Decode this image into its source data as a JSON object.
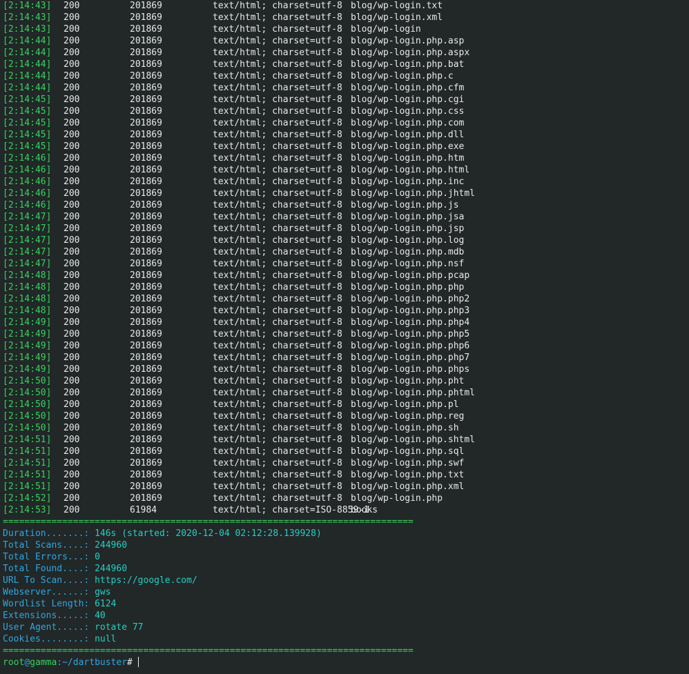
{
  "log_entries": [
    {
      "time": "[2:14:43]",
      "status": "200",
      "size": "201869",
      "content_type": "text/html; charset=utf-8",
      "path": "blog/wp-login.txt"
    },
    {
      "time": "[2:14:43]",
      "status": "200",
      "size": "201869",
      "content_type": "text/html; charset=utf-8",
      "path": "blog/wp-login.xml"
    },
    {
      "time": "[2:14:43]",
      "status": "200",
      "size": "201869",
      "content_type": "text/html; charset=utf-8",
      "path": "blog/wp-login"
    },
    {
      "time": "[2:14:44]",
      "status": "200",
      "size": "201869",
      "content_type": "text/html; charset=utf-8",
      "path": "blog/wp-login.php.asp"
    },
    {
      "time": "[2:14:44]",
      "status": "200",
      "size": "201869",
      "content_type": "text/html; charset=utf-8",
      "path": "blog/wp-login.php.aspx"
    },
    {
      "time": "[2:14:44]",
      "status": "200",
      "size": "201869",
      "content_type": "text/html; charset=utf-8",
      "path": "blog/wp-login.php.bat"
    },
    {
      "time": "[2:14:44]",
      "status": "200",
      "size": "201869",
      "content_type": "text/html; charset=utf-8",
      "path": "blog/wp-login.php.c"
    },
    {
      "time": "[2:14:44]",
      "status": "200",
      "size": "201869",
      "content_type": "text/html; charset=utf-8",
      "path": "blog/wp-login.php.cfm"
    },
    {
      "time": "[2:14:45]",
      "status": "200",
      "size": "201869",
      "content_type": "text/html; charset=utf-8",
      "path": "blog/wp-login.php.cgi"
    },
    {
      "time": "[2:14:45]",
      "status": "200",
      "size": "201869",
      "content_type": "text/html; charset=utf-8",
      "path": "blog/wp-login.php.css"
    },
    {
      "time": "[2:14:45]",
      "status": "200",
      "size": "201869",
      "content_type": "text/html; charset=utf-8",
      "path": "blog/wp-login.php.com"
    },
    {
      "time": "[2:14:45]",
      "status": "200",
      "size": "201869",
      "content_type": "text/html; charset=utf-8",
      "path": "blog/wp-login.php.dll"
    },
    {
      "time": "[2:14:45]",
      "status": "200",
      "size": "201869",
      "content_type": "text/html; charset=utf-8",
      "path": "blog/wp-login.php.exe"
    },
    {
      "time": "[2:14:46]",
      "status": "200",
      "size": "201869",
      "content_type": "text/html; charset=utf-8",
      "path": "blog/wp-login.php.htm"
    },
    {
      "time": "[2:14:46]",
      "status": "200",
      "size": "201869",
      "content_type": "text/html; charset=utf-8",
      "path": "blog/wp-login.php.html"
    },
    {
      "time": "[2:14:46]",
      "status": "200",
      "size": "201869",
      "content_type": "text/html; charset=utf-8",
      "path": "blog/wp-login.php.inc"
    },
    {
      "time": "[2:14:46]",
      "status": "200",
      "size": "201869",
      "content_type": "text/html; charset=utf-8",
      "path": "blog/wp-login.php.jhtml"
    },
    {
      "time": "[2:14:46]",
      "status": "200",
      "size": "201869",
      "content_type": "text/html; charset=utf-8",
      "path": "blog/wp-login.php.js"
    },
    {
      "time": "[2:14:47]",
      "status": "200",
      "size": "201869",
      "content_type": "text/html; charset=utf-8",
      "path": "blog/wp-login.php.jsa"
    },
    {
      "time": "[2:14:47]",
      "status": "200",
      "size": "201869",
      "content_type": "text/html; charset=utf-8",
      "path": "blog/wp-login.php.jsp"
    },
    {
      "time": "[2:14:47]",
      "status": "200",
      "size": "201869",
      "content_type": "text/html; charset=utf-8",
      "path": "blog/wp-login.php.log"
    },
    {
      "time": "[2:14:47]",
      "status": "200",
      "size": "201869",
      "content_type": "text/html; charset=utf-8",
      "path": "blog/wp-login.php.mdb"
    },
    {
      "time": "[2:14:47]",
      "status": "200",
      "size": "201869",
      "content_type": "text/html; charset=utf-8",
      "path": "blog/wp-login.php.nsf"
    },
    {
      "time": "[2:14:48]",
      "status": "200",
      "size": "201869",
      "content_type": "text/html; charset=utf-8",
      "path": "blog/wp-login.php.pcap"
    },
    {
      "time": "[2:14:48]",
      "status": "200",
      "size": "201869",
      "content_type": "text/html; charset=utf-8",
      "path": "blog/wp-login.php.php"
    },
    {
      "time": "[2:14:48]",
      "status": "200",
      "size": "201869",
      "content_type": "text/html; charset=utf-8",
      "path": "blog/wp-login.php.php2"
    },
    {
      "time": "[2:14:48]",
      "status": "200",
      "size": "201869",
      "content_type": "text/html; charset=utf-8",
      "path": "blog/wp-login.php.php3"
    },
    {
      "time": "[2:14:49]",
      "status": "200",
      "size": "201869",
      "content_type": "text/html; charset=utf-8",
      "path": "blog/wp-login.php.php4"
    },
    {
      "time": "[2:14:49]",
      "status": "200",
      "size": "201869",
      "content_type": "text/html; charset=utf-8",
      "path": "blog/wp-login.php.php5"
    },
    {
      "time": "[2:14:49]",
      "status": "200",
      "size": "201869",
      "content_type": "text/html; charset=utf-8",
      "path": "blog/wp-login.php.php6"
    },
    {
      "time": "[2:14:49]",
      "status": "200",
      "size": "201869",
      "content_type": "text/html; charset=utf-8",
      "path": "blog/wp-login.php.php7"
    },
    {
      "time": "[2:14:49]",
      "status": "200",
      "size": "201869",
      "content_type": "text/html; charset=utf-8",
      "path": "blog/wp-login.php.phps"
    },
    {
      "time": "[2:14:50]",
      "status": "200",
      "size": "201869",
      "content_type": "text/html; charset=utf-8",
      "path": "blog/wp-login.php.pht"
    },
    {
      "time": "[2:14:50]",
      "status": "200",
      "size": "201869",
      "content_type": "text/html; charset=utf-8",
      "path": "blog/wp-login.php.phtml"
    },
    {
      "time": "[2:14:50]",
      "status": "200",
      "size": "201869",
      "content_type": "text/html; charset=utf-8",
      "path": "blog/wp-login.php.pl"
    },
    {
      "time": "[2:14:50]",
      "status": "200",
      "size": "201869",
      "content_type": "text/html; charset=utf-8",
      "path": "blog/wp-login.php.reg"
    },
    {
      "time": "[2:14:50]",
      "status": "200",
      "size": "201869",
      "content_type": "text/html; charset=utf-8",
      "path": "blog/wp-login.php.sh"
    },
    {
      "time": "[2:14:51]",
      "status": "200",
      "size": "201869",
      "content_type": "text/html; charset=utf-8",
      "path": "blog/wp-login.php.shtml"
    },
    {
      "time": "[2:14:51]",
      "status": "200",
      "size": "201869",
      "content_type": "text/html; charset=utf-8",
      "path": "blog/wp-login.php.sql"
    },
    {
      "time": "[2:14:51]",
      "status": "200",
      "size": "201869",
      "content_type": "text/html; charset=utf-8",
      "path": "blog/wp-login.php.swf"
    },
    {
      "time": "[2:14:51]",
      "status": "200",
      "size": "201869",
      "content_type": "text/html; charset=utf-8",
      "path": "blog/wp-login.php.txt"
    },
    {
      "time": "[2:14:51]",
      "status": "200",
      "size": "201869",
      "content_type": "text/html; charset=utf-8",
      "path": "blog/wp-login.php.xml"
    },
    {
      "time": "[2:14:52]",
      "status": "200",
      "size": "201869",
      "content_type": "text/html; charset=utf-8",
      "path": "blog/wp-login.php"
    },
    {
      "time": "[2:14:53]",
      "status": "200",
      "size": "61984",
      "content_type": "text/html; charset=ISO-8859-1",
      "path": "books"
    }
  ],
  "separator": "============================================================================",
  "summary": [
    {
      "key": "Duration.......:",
      "value": "146s (started: 2020-12-04 02:12:28.139928)"
    },
    {
      "key": "Total Scans....:",
      "value": "244960"
    },
    {
      "key": "Total Errors...:",
      "value": "0"
    },
    {
      "key": "Total Found....:",
      "value": "244960"
    },
    {
      "key": "URL To Scan....:",
      "value": "https://google.com/"
    },
    {
      "key": "Webserver......:",
      "value": "gws"
    },
    {
      "key": "Wordlist Length:",
      "value": "6124"
    },
    {
      "key": "Extensions.....:",
      "value": "40"
    },
    {
      "key": "User Agent.....:",
      "value": "rotate 77"
    },
    {
      "key": "Cookies........:",
      "value": "null"
    }
  ],
  "prompt": {
    "user": "root",
    "at": "@",
    "host": "gamma",
    "colon": ":",
    "dir": "~/dartbuster",
    "symbol": "#"
  },
  "colors": {
    "background": "#222728",
    "timestamp": "#35d45d",
    "key": "#2fa7e0",
    "value": "#25d0c2",
    "text": "#eaeaea"
  }
}
